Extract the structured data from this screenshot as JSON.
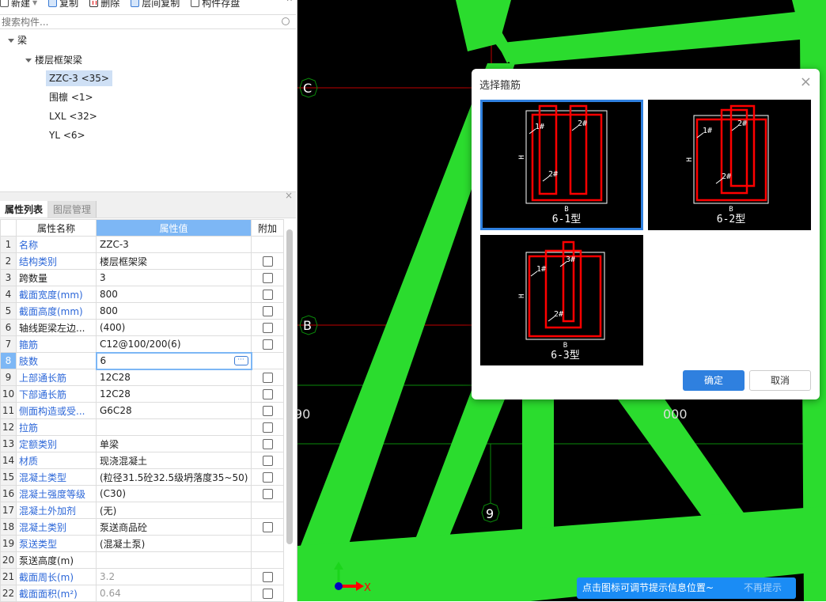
{
  "toolbar": {
    "items": [
      {
        "label": "新建",
        "icon": "new-icon"
      },
      {
        "label": "复制",
        "icon": "copy-icon"
      },
      {
        "label": "删除",
        "icon": "delete-icon"
      },
      {
        "label": "层间复制",
        "icon": "floor-copy-icon"
      },
      {
        "label": "构件存盘",
        "icon": "save-component-icon"
      }
    ]
  },
  "search": {
    "placeholder": "搜索构件..."
  },
  "tree": {
    "root": "梁",
    "group": "楼层框架梁",
    "items": [
      "ZZC-3 <35>",
      "围檩 <1>",
      "LXL <32>",
      "YL <6>"
    ],
    "selected": 0
  },
  "tabs": [
    "属性列表",
    "图层管理"
  ],
  "grid": {
    "headers": [
      "属性名称",
      "属性值",
      "附加"
    ],
    "rows": [
      {
        "n": "1",
        "name": "名称",
        "value": "ZZC-3",
        "blue": true,
        "chk": false
      },
      {
        "n": "2",
        "name": "结构类别",
        "value": "楼层框架梁",
        "blue": true,
        "chk": true
      },
      {
        "n": "3",
        "name": "跨数量",
        "value": "3",
        "blue": false,
        "chk": true
      },
      {
        "n": "4",
        "name": "截面宽度(mm)",
        "value": "800",
        "blue": true,
        "chk": true
      },
      {
        "n": "5",
        "name": "截面高度(mm)",
        "value": "800",
        "blue": true,
        "chk": true
      },
      {
        "n": "6",
        "name": "轴线距梁左边...",
        "value": "(400)",
        "blue": false,
        "chk": true
      },
      {
        "n": "7",
        "name": "箍筋",
        "value": "C12@100/200(6)",
        "blue": true,
        "chk": true
      },
      {
        "n": "8",
        "name": "肢数",
        "value": "6",
        "blue": true,
        "chk": false,
        "editing": true
      },
      {
        "n": "9",
        "name": "上部通长筋",
        "value": "12C28",
        "blue": true,
        "chk": true
      },
      {
        "n": "10",
        "name": "下部通长筋",
        "value": "12C28",
        "blue": true,
        "chk": true
      },
      {
        "n": "11",
        "name": "侧面构造或受...",
        "value": "G6C28",
        "blue": true,
        "chk": true
      },
      {
        "n": "12",
        "name": "拉筋",
        "value": "",
        "blue": true,
        "chk": true
      },
      {
        "n": "13",
        "name": "定额类别",
        "value": "单梁",
        "blue": true,
        "chk": true
      },
      {
        "n": "14",
        "name": "材质",
        "value": "现浇混凝土",
        "blue": true,
        "chk": true
      },
      {
        "n": "15",
        "name": "混凝土类型",
        "value": "(粒径31.5砼32.5级坍落度35~50)",
        "blue": true,
        "chk": true
      },
      {
        "n": "16",
        "name": "混凝土强度等级",
        "value": "(C30)",
        "blue": true,
        "chk": true
      },
      {
        "n": "17",
        "name": "混凝土外加剂",
        "value": "(无)",
        "blue": true,
        "chk": false
      },
      {
        "n": "18",
        "name": "混凝土类别",
        "value": "泵送商品砼",
        "blue": true,
        "chk": true
      },
      {
        "n": "19",
        "name": "泵送类型",
        "value": "(混凝土泵)",
        "blue": true,
        "chk": false
      },
      {
        "n": "20",
        "name": "泵送高度(m)",
        "value": "",
        "blue": false,
        "chk": false
      },
      {
        "n": "21",
        "name": "截面周长(m)",
        "value": "3.2",
        "blue": true,
        "chk": true,
        "gray": true
      },
      {
        "n": "22",
        "name": "截面面积(m²)",
        "value": "0.64",
        "blue": true,
        "chk": true,
        "gray": true
      }
    ]
  },
  "canvas": {
    "axes": [
      "C",
      "B",
      "9"
    ],
    "dims": [
      "90",
      "000"
    ],
    "axis_x": "X"
  },
  "dialog": {
    "title": "选择箍筋",
    "options": [
      {
        "label": "6-1型",
        "tags": [
          "1#",
          "2#",
          "2#"
        ],
        "selected": true
      },
      {
        "label": "6-2型",
        "tags": [
          "1#",
          "2#",
          "2#"
        ],
        "selected": false
      },
      {
        "label": "6-3型",
        "tags": [
          "1#",
          "3#",
          "2#"
        ],
        "selected": false
      }
    ],
    "dim_h": "H",
    "dim_b": "B",
    "ok": "确定",
    "cancel": "取消"
  },
  "hint": {
    "text": "点击图标可调节提示信息位置~",
    "dismiss": "不再提示"
  },
  "colors": {
    "beam": "#2bdc2e",
    "accent": "#2f80df",
    "rebar": "#ff0000"
  }
}
